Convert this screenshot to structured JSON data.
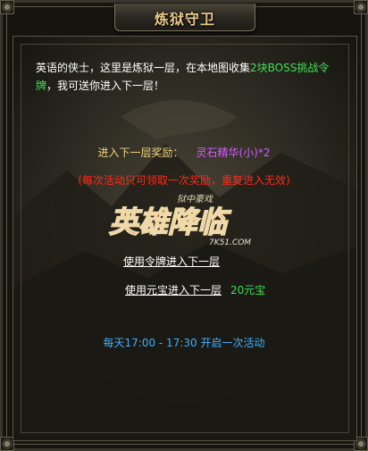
{
  "window": {
    "title": "炼狱守卫"
  },
  "intro": {
    "text_part1": "英语的侠士，这里是炼狱一层，在本地图收集",
    "highlight": "2块BOSS挑战令牌",
    "text_part2": "，我可送你进入下一层！"
  },
  "reward": {
    "label": "进入下一层奖励：",
    "value": "灵石精华(小)*2"
  },
  "notice": "(每次活动只可领取一次奖励，重复进入无效)",
  "logo": {
    "small_text": "狱中豪戏",
    "main_text": "英雄降临",
    "site_text": "7K51.COM"
  },
  "actions": {
    "use_token": "使用令牌进入下一层",
    "use_ingot": "使用元宝进入下一层",
    "ingot_price": "20元宝"
  },
  "schedule": "每天17:00 - 17:30 开启一次活动",
  "colors": {
    "title": "#e7c98a",
    "highlight_green": "#3ee055",
    "reward_label": "#f1d27a",
    "reward_value": "#d25cff",
    "notice_red": "#ff2a1a",
    "schedule_blue": "#3fb0ff"
  }
}
